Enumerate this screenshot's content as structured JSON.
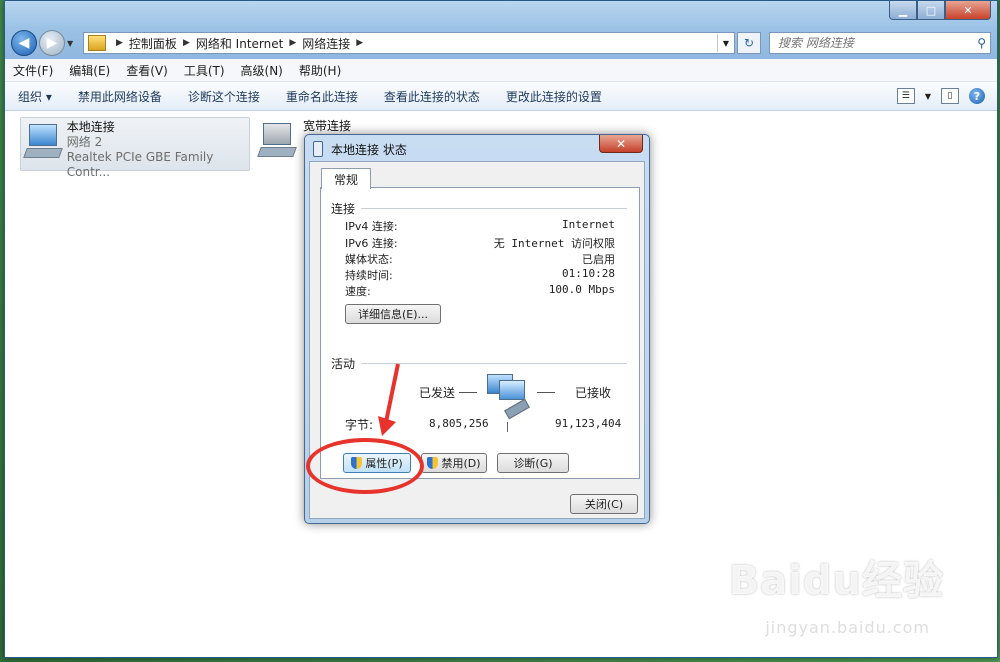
{
  "address": {
    "crumbs": [
      "控制面板",
      "网络和 Internet",
      "网络连接"
    ],
    "search_placeholder": "搜索 网络连接"
  },
  "menu": [
    "文件(F)",
    "编辑(E)",
    "查看(V)",
    "工具(T)",
    "高级(N)",
    "帮助(H)"
  ],
  "toolbar": {
    "organize": "组织 ▾",
    "items": [
      "禁用此网络设备",
      "诊断这个连接",
      "重命名此连接",
      "查看此连接的状态",
      "更改此连接的设置"
    ]
  },
  "connections": [
    {
      "name": "本地连接",
      "network": "网络 2",
      "adapter": "Realtek PCIe GBE Family Contr..."
    },
    {
      "name": "宽带连接"
    }
  ],
  "dialog": {
    "title": "本地连接 状态",
    "tab": "常规",
    "connection_section": "连接",
    "rows": [
      {
        "label": "IPv4 连接:",
        "value": "Internet"
      },
      {
        "label": "IPv6 连接:",
        "value": "无 Internet 访问权限"
      },
      {
        "label": "媒体状态:",
        "value": "已启用"
      },
      {
        "label": "持续时间:",
        "value": "01:10:28"
      },
      {
        "label": "速度:",
        "value": "100.0 Mbps"
      }
    ],
    "details_button": "详细信息(E)...",
    "activity_section": "活动",
    "sent_label": "已发送",
    "received_label": "已接收",
    "bytes_label": "字节:",
    "bytes_sent": "8,805,256",
    "bytes_received": "91,123,404",
    "properties_button": "属性(P)",
    "disable_button": "禁用(D)",
    "diagnose_button": "诊断(G)",
    "close_button": "关闭(C)"
  },
  "watermark": {
    "brand": "Baidu经验",
    "url": "jingyan.baidu.com"
  },
  "colors": {
    "annotation_red": "#e8322c",
    "title_glass": "#9cc3e6",
    "accent_blue": "#1a5fb0"
  }
}
